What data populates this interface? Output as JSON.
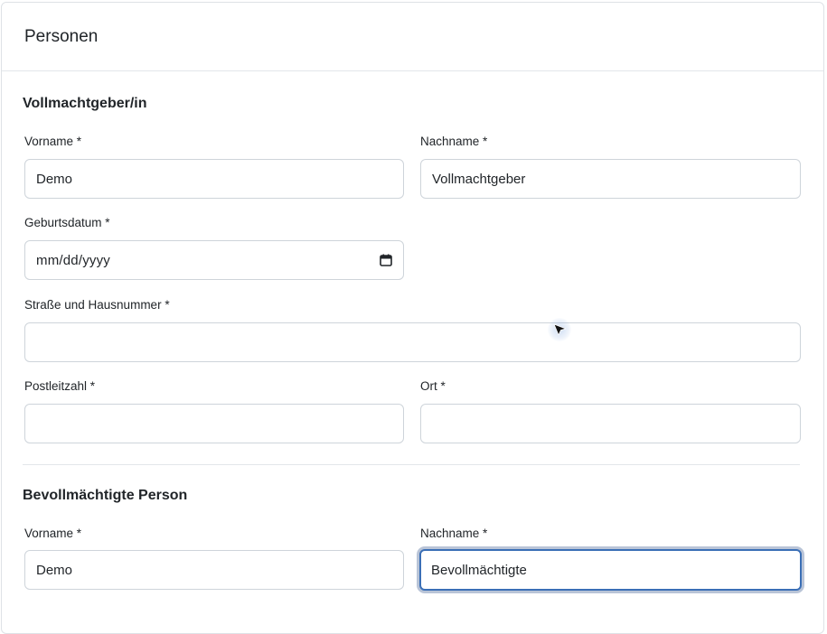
{
  "card": {
    "title": "Personen"
  },
  "grantor": {
    "section_title": "Vollmachtgeber/in",
    "first_name": {
      "label": "Vorname *",
      "value": "Demo"
    },
    "last_name": {
      "label": "Nachname *",
      "value": "Vollmachtgeber"
    },
    "birthdate": {
      "label": "Geburtsdatum *",
      "placeholder": "mm/dd/yyyy"
    },
    "street": {
      "label": "Straße und Hausnummer *",
      "value": ""
    },
    "postal_code": {
      "label": "Postleitzahl *",
      "value": ""
    },
    "city": {
      "label": "Ort *",
      "value": ""
    }
  },
  "attorney": {
    "section_title": "Bevollmächtigte Person",
    "first_name": {
      "label": "Vorname *",
      "value": "Demo"
    },
    "last_name": {
      "label": "Nachname *",
      "value": "Bevollmächtigte"
    }
  },
  "colors": {
    "border": "#ced4da",
    "focus_border": "#3b6fb6",
    "divider": "#e3e6ea",
    "text": "#212529"
  },
  "icons": {
    "calendar": "calendar-icon",
    "cursor": "mouse-pointer-icon"
  }
}
